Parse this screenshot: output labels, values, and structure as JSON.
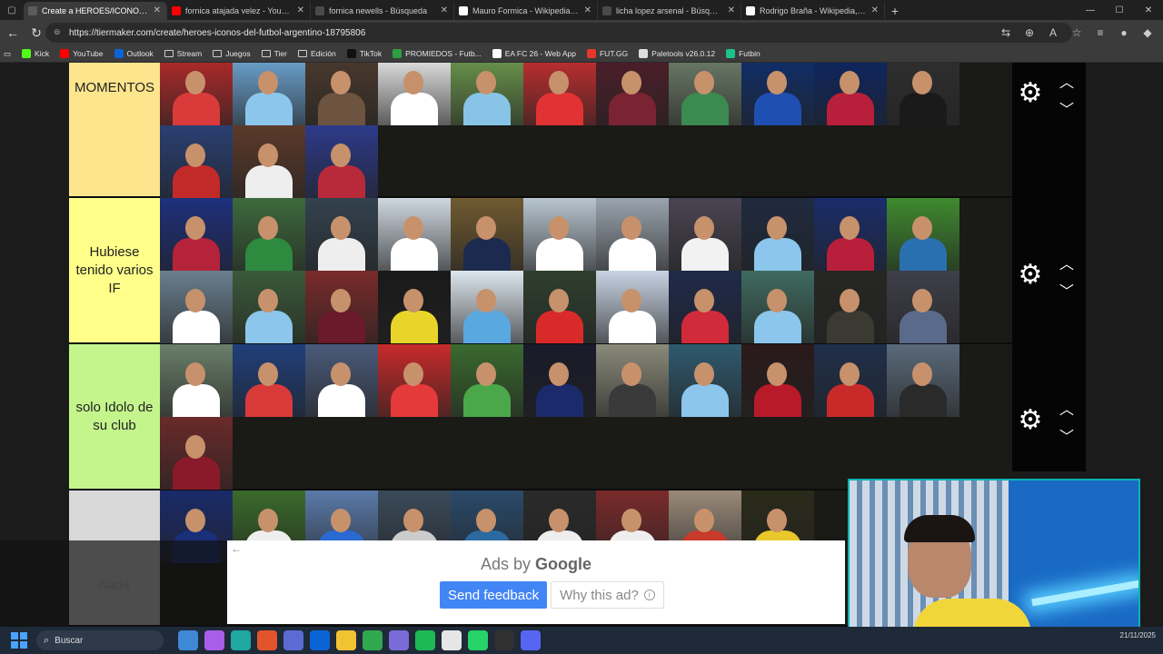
{
  "tabs": [
    {
      "label": "Create a HEROES/ICONOS del FU",
      "favicon_color": "#5b5b5b",
      "active": true
    },
    {
      "label": "fornica atajada velez - YouTube",
      "favicon_color": "#ff0000",
      "active": false
    },
    {
      "label": "fornica newells - Búsqueda",
      "favicon_color": "#4a4a4a",
      "active": false
    },
    {
      "label": "Mauro Formica - Wikipedia, la en",
      "favicon_color": "#ffffff",
      "active": false
    },
    {
      "label": "licha lopez arsenal - Búsqueda In",
      "favicon_color": "#4a4a4a",
      "active": false
    },
    {
      "label": "Rodrigo Braña - Wikipedia, la enc",
      "favicon_color": "#ffffff",
      "active": false
    }
  ],
  "address": {
    "url": "https://tiermaker.com/create/heroes-iconos-del-futbol-argentino-18795806"
  },
  "bookmarks": [
    {
      "label": "Kick",
      "color": "#53fc18"
    },
    {
      "label": "YouTube",
      "color": "#ff0000"
    },
    {
      "label": "Outlook",
      "color": "#0a64d6"
    },
    {
      "label": "Stream",
      "folder": true
    },
    {
      "label": "Juegos",
      "folder": true
    },
    {
      "label": "Tier",
      "folder": true
    },
    {
      "label": "Edición",
      "folder": true
    },
    {
      "label": "TikTok",
      "color": "#111111"
    },
    {
      "label": "PROMIEDOS - Futb...",
      "color": "#2c9f3f"
    },
    {
      "label": "EA FC 26 - Web App",
      "color": "#ffffff"
    },
    {
      "label": "FUT.GG",
      "color": "#e8372c"
    },
    {
      "label": "Paletools v26.0.12",
      "color": "#dddddd"
    },
    {
      "label": "Futbin",
      "color": "#1ec38a"
    }
  ],
  "tiers": [
    {
      "label": "MOMENTOS",
      "color": "#fde58d",
      "players": [
        {
          "bg": "#b72a2a",
          "shirt": "#d93b3b"
        },
        {
          "bg": "#6fa9d8",
          "shirt": "#8cc6ec"
        },
        {
          "bg": "#4b3a2e",
          "shirt": "#6c5440"
        },
        {
          "bg": "#ececec",
          "shirt": "#ffffff"
        },
        {
          "bg": "#6d9a4f",
          "shirt": "#87c4e6"
        },
        {
          "bg": "#c72f2f",
          "shirt": "#e13333"
        },
        {
          "bg": "#4f1e2a",
          "shirt": "#7a2433"
        },
        {
          "bg": "#6f7f6b",
          "shirt": "#3b8a4f"
        },
        {
          "bg": "#0f2f6e",
          "shirt": "#1f4fb0"
        },
        {
          "bg": "#0d2663",
          "shirt": "#b81f3a"
        },
        {
          "bg": "#2f2f2f",
          "shirt": "#1a1a1a"
        },
        {
          "bg": "#2a3f72",
          "shirt": "#c22a2a"
        },
        {
          "bg": "#5c3a2a",
          "shirt": "#eeeeee"
        },
        {
          "bg": "#2d3a8a",
          "shirt": "#b82a3a"
        }
      ]
    },
    {
      "label": "Hubiese tenido varios IF",
      "color": "#ffff8a",
      "players": [
        {
          "bg": "#1e2f7d",
          "shirt": "#b5233a"
        },
        {
          "bg": "#3d6a3d",
          "shirt": "#2e8a3e"
        },
        {
          "bg": "#33424f",
          "shirt": "#eeeeee"
        },
        {
          "bg": "#cfd8e0",
          "shirt": "#ffffff"
        },
        {
          "bg": "#705a30",
          "shirt": "#1c2a4f"
        },
        {
          "bg": "#b8c6d0",
          "shirt": "#ffffff"
        },
        {
          "bg": "#9aa4ae",
          "shirt": "#ffffff"
        },
        {
          "bg": "#4a4452",
          "shirt": "#f2f2f2"
        },
        {
          "bg": "#1f2a3f",
          "shirt": "#8cc6ec"
        },
        {
          "bg": "#1a2d6b",
          "shirt": "#b81f3a"
        },
        {
          "bg": "#3f8a2f",
          "shirt": "#2a6fb0"
        },
        {
          "bg": "#6a7f8f",
          "shirt": "#ffffff"
        },
        {
          "bg": "#3a5a3a",
          "shirt": "#8cc6ec"
        },
        {
          "bg": "#7a2a2a",
          "shirt": "#6a1a2a"
        },
        {
          "bg": "#1a1a1a",
          "shirt": "#e9d42a"
        },
        {
          "bg": "#dde6ee",
          "shirt": "#5aa8e0"
        },
        {
          "bg": "#2f3f2f",
          "shirt": "#d92a2a"
        },
        {
          "bg": "#c8d4e4",
          "shirt": "#ffffff"
        },
        {
          "bg": "#1f2a4a",
          "shirt": "#d12a3a"
        },
        {
          "bg": "#3f6a5f",
          "shirt": "#8cc6ec"
        },
        {
          "bg": "#262622",
          "shirt": "#3a3a33"
        },
        {
          "bg": "#3f3f4a",
          "shirt": "#5a6a8a"
        }
      ]
    },
    {
      "label": "solo Idolo de su club",
      "color": "#c4f58c",
      "players": [
        {
          "bg": "#6a7f6a",
          "shirt": "#ffffff"
        },
        {
          "bg": "#1f3f7a",
          "shirt": "#d83a3a"
        },
        {
          "bg": "#4a5a7a",
          "shirt": "#ffffff"
        },
        {
          "bg": "#c82a2a",
          "shirt": "#e43a3a"
        },
        {
          "bg": "#3a6a2f",
          "shirt": "#4aa84a"
        },
        {
          "bg": "#1a1a2a",
          "shirt": "#1a2a6a"
        },
        {
          "bg": "#8a8a7a",
          "shirt": "#3a3a3a"
        },
        {
          "bg": "#2f5a6f",
          "shirt": "#8cc6ec"
        },
        {
          "bg": "#2a1a1a",
          "shirt": "#b81a2a"
        },
        {
          "bg": "#1f2f4a",
          "shirt": "#c82a2a"
        },
        {
          "bg": "#5a6a7a",
          "shirt": "#2a2a2a"
        },
        {
          "bg": "#6a2a2a",
          "shirt": "#8a1a2a"
        }
      ]
    },
    {
      "label": "",
      "color": "#d9d9d9",
      "players": [
        {
          "bg": "#1a2a6a",
          "shirt": "#1a2f7a"
        },
        {
          "bg": "#3a6a2a",
          "shirt": "#eeeeee"
        },
        {
          "bg": "#5a7aaa",
          "shirt": "#2a6ad0"
        },
        {
          "bg": "#3a4a5a",
          "shirt": "#cccccc"
        },
        {
          "bg": "#2a4a6a",
          "shirt": "#2a6aa0"
        },
        {
          "bg": "#2a2a2a",
          "shirt": "#eeeeee"
        },
        {
          "bg": "#7a2a2a",
          "shirt": "#eeeeee"
        },
        {
          "bg": "#9a8a7a",
          "shirt": "#c83a2a"
        },
        {
          "bg": "#2a2a1a",
          "shirt": "#e8c82a"
        }
      ]
    }
  ],
  "nada_label": "Nada",
  "ad": {
    "prefix": "Ads by",
    "brand": "Google",
    "feedback": "Send feedback",
    "why": "Why this ad?",
    "info_glyph": "i"
  },
  "taskbar": {
    "search_placeholder": "Buscar",
    "date": "21/11/2025",
    "apps": [
      {
        "name": "widgets",
        "color": "#3f88d6"
      },
      {
        "name": "copilot",
        "color": "#a95ee8"
      },
      {
        "name": "edge",
        "color": "#1fa8a0"
      },
      {
        "name": "brave",
        "color": "#e2552c"
      },
      {
        "name": "teams",
        "color": "#5c6bd4"
      },
      {
        "name": "outlook",
        "color": "#0a64d6"
      },
      {
        "name": "explorer",
        "color": "#f1c232"
      },
      {
        "name": "chrome",
        "color": "#2fa84f"
      },
      {
        "name": "discord-alt",
        "color": "#7b6bd8"
      },
      {
        "name": "spotify",
        "color": "#1db954"
      },
      {
        "name": "capcut",
        "color": "#e6e6e6"
      },
      {
        "name": "whatsapp",
        "color": "#25d366"
      },
      {
        "name": "obs",
        "color": "#303030"
      },
      {
        "name": "discord",
        "color": "#5865f2"
      }
    ]
  }
}
